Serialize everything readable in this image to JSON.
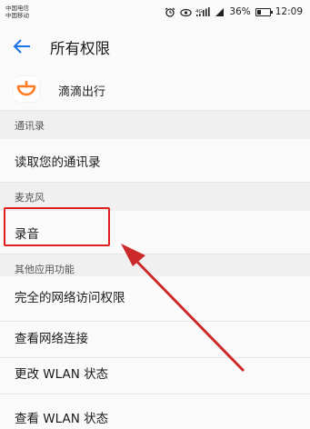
{
  "status_bar": {
    "carrier_1": "中国电信",
    "carrier_2": "中国移动",
    "network_label": "4G",
    "battery_percent": "36%",
    "battery_level": 0.36,
    "time": "12:09"
  },
  "header": {
    "title": "所有权限"
  },
  "app": {
    "name": "滴滴出行",
    "brand_color": "#ff7a21"
  },
  "sections": [
    {
      "header": "通讯录",
      "items": [
        "读取您的通讯录"
      ]
    },
    {
      "header": "麦克风",
      "items": [
        "录音"
      ]
    },
    {
      "header": "其他应用功能",
      "items": [
        "完全的网络访问权限",
        "查看网络连接",
        "更改 WLAN 状态",
        "查看 WLAN 状态"
      ]
    }
  ],
  "colors": {
    "accent": "#1a73e8",
    "highlight": "#e02020",
    "arrow": "#cc2a2a"
  }
}
